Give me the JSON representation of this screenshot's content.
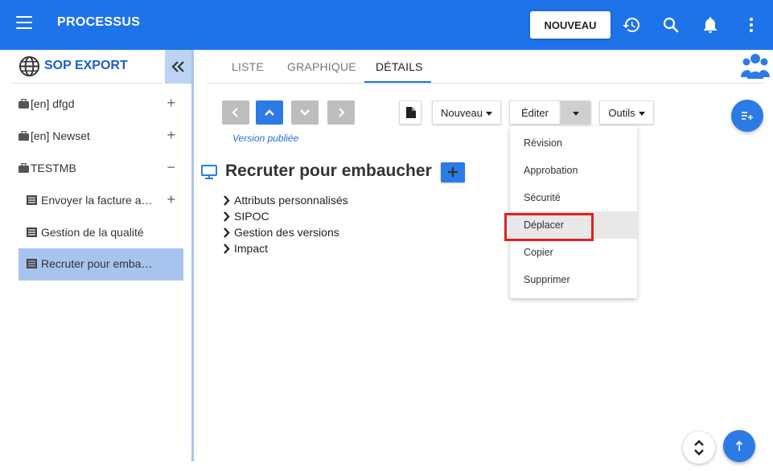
{
  "app": {
    "title": "PROCESSUS",
    "new_button_label": "NOUVEAU"
  },
  "sidebar": {
    "title": "SOP EXPORT",
    "items": [
      {
        "label": "[en] dfgd",
        "toggle": "+",
        "icon": "briefcase-icon"
      },
      {
        "label": "[en] Newset",
        "toggle": "+",
        "icon": "briefcase-icon"
      },
      {
        "label": "TESTMB",
        "toggle": "−",
        "icon": "briefcase-icon"
      },
      {
        "label": "Envoyer la facture au client",
        "toggle": "+",
        "icon": "process-list-icon"
      },
      {
        "label": "Gestion de la qualité",
        "toggle": "",
        "icon": "process-list-icon"
      },
      {
        "label": "Recruter pour embaucher",
        "toggle": "",
        "icon": "process-list-icon",
        "active": true
      }
    ]
  },
  "tabs": [
    {
      "label": "LISTE"
    },
    {
      "label": "GRAPHIQUE"
    },
    {
      "label": "DÉTAILS",
      "active": true
    }
  ],
  "toolbar": {
    "version_label": "Version publiée",
    "nouveau_label": "Nouveau",
    "editer_label": "Éditer",
    "outils_label": "Outils"
  },
  "page": {
    "title": "Recruter pour embaucher",
    "sections": [
      {
        "label": "Attributs personnalisés"
      },
      {
        "label": "SIPOC"
      },
      {
        "label": "Gestion des versions"
      },
      {
        "label": "Impact"
      }
    ]
  },
  "dropdown": {
    "items": [
      {
        "label": "Révision"
      },
      {
        "label": "Approbation"
      },
      {
        "label": "Sécurité"
      },
      {
        "label": "Déplacer",
        "highlighted": true
      },
      {
        "label": "Copier"
      },
      {
        "label": "Supprimer"
      }
    ]
  },
  "colors": {
    "primary": "#1f73e8",
    "accent_blue": "#2c7be5",
    "selected_row": "#a7c4ef",
    "highlight_border": "#e41e1e"
  }
}
